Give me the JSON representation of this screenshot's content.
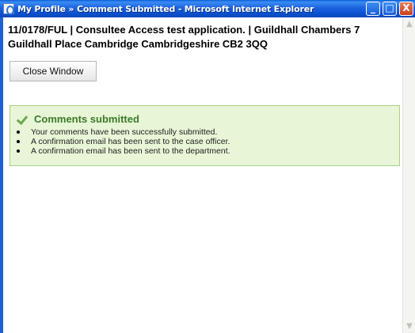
{
  "window": {
    "title": "My Profile » Comment Submitted - Microsoft Internet Explorer",
    "minimize_glyph": "_",
    "maximize_glyph": "□",
    "close_glyph": "X"
  },
  "page": {
    "application_heading": "11/0178/FUL  |  Consultee Access test application.  |  Guildhall Chambers 7 Guildhall Place Cambridge Cambridgeshire CB2 3QQ",
    "close_window_label": "Close Window",
    "success": {
      "title": "Comments submitted",
      "messages": [
        "Your comments have been successfully submitted.",
        "A confirmation email has been sent to the case officer.",
        "A confirmation email has been sent to the department."
      ],
      "accent_color": "#3b7a2a",
      "background_color": "#e8f5d6"
    }
  },
  "scrollbar": {
    "up_glyph": "▲",
    "down_glyph": "▼"
  }
}
